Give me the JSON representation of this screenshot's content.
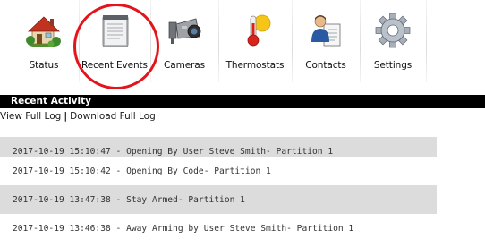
{
  "nav": {
    "items": [
      {
        "id": "status",
        "label": "Status",
        "icon": "house-icon"
      },
      {
        "id": "recent-events",
        "label": "Recent Events",
        "icon": "notepad-icon"
      },
      {
        "id": "cameras",
        "label": "Cameras",
        "icon": "camera-icon"
      },
      {
        "id": "thermostats",
        "label": "Thermostats",
        "icon": "thermometer-icon"
      },
      {
        "id": "contacts",
        "label": "Contacts",
        "icon": "contact-card-icon"
      },
      {
        "id": "settings",
        "label": "Settings",
        "icon": "gear-icon"
      }
    ],
    "highlighted": "recent-events",
    "highlight_color": "#e3141b"
  },
  "recent_activity": {
    "title": "Recent Activity",
    "view_full_log": "View Full Log",
    "separator": "|",
    "download_full_log": "Download Full Log",
    "entries": [
      {
        "text": "2017-10-19 15:10:47 - Opening By User Steve Smith- Partition 1"
      },
      {
        "text": "2017-10-19 15:10:42 - Opening By Code- Partition 1"
      },
      {
        "text": "2017-10-19 13:47:38 - Stay Armed- Partition 1"
      },
      {
        "text": "2017-10-19 13:46:38 - Away Arming by User Steve Smith- Partition 1"
      }
    ]
  },
  "colors": {
    "header_bg": "#000000",
    "row_shaded": "#dcdcdc"
  }
}
